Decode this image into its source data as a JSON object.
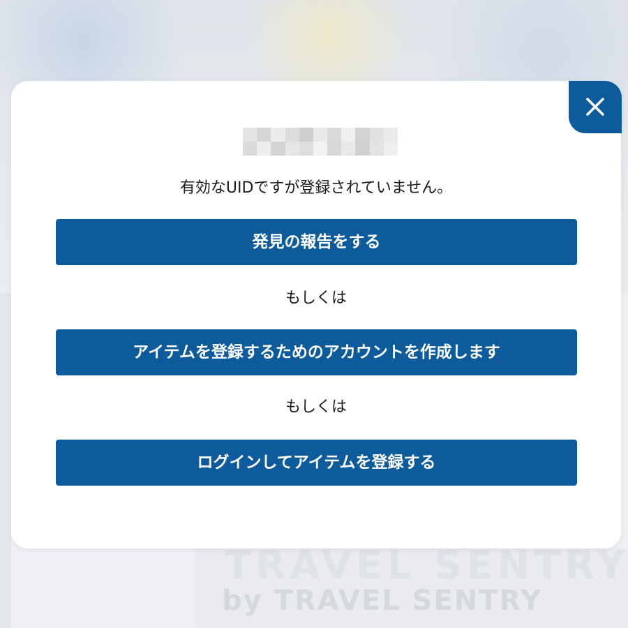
{
  "background": {
    "brand_text": "by TRAVEL SENTRY"
  },
  "modal": {
    "close_icon": "close-icon",
    "uid_redacted": true,
    "message": "有効なUIDですが登録されていません。",
    "buttons": {
      "report_label": "発見の報告をする",
      "create_account_label": "アイテムを登録するためのアカウントを作成します",
      "login_label": "ログインしてアイテムを登録する"
    },
    "separator_1": "もしくは",
    "separator_2": "もしくは"
  },
  "colors": {
    "accent": "#0d5b9b",
    "modal_background": "#ffffff",
    "text": "#1a1a1a"
  }
}
